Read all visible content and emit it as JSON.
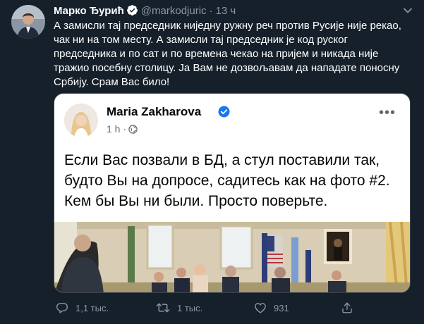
{
  "tweet": {
    "author_name": "Марко Ђурић",
    "handle": "@markodjuric",
    "separator": "·",
    "time": "13 ч",
    "text": "А замисли тај председник ниједну ружну реч против Русије није рекао,\nчак ни на том месту. А замисли тај председник је код руског\nпредседника и по сат и по времена чекао на пријем и никада није\nтражио посебну столицу. Ја Вам не дозвољавам да нападате поносну\nСрбију. Срам Вас било!"
  },
  "card": {
    "author": "Maria Zakharova",
    "time": "1 h",
    "separator": "·",
    "text": "Если Вас позвали в БД, а стул поставили так, будто Вы на допросе, садитесь как на фото #2. Кем бы Вы ни были. Просто поверьте.",
    "more": "•••"
  },
  "actions": {
    "reply_count": "1,1 тыс.",
    "retweet_count": "1 тыс.",
    "like_count": "931"
  },
  "colors": {
    "background": "#15202b",
    "secondary_text": "#8899a6",
    "verified_blue": "#1da1f2",
    "fb_verified": "#1877f2"
  },
  "icons": [
    "verified-badge-icon",
    "caret-down-icon",
    "globe-icon",
    "reply-icon",
    "retweet-icon",
    "like-icon",
    "share-icon"
  ]
}
